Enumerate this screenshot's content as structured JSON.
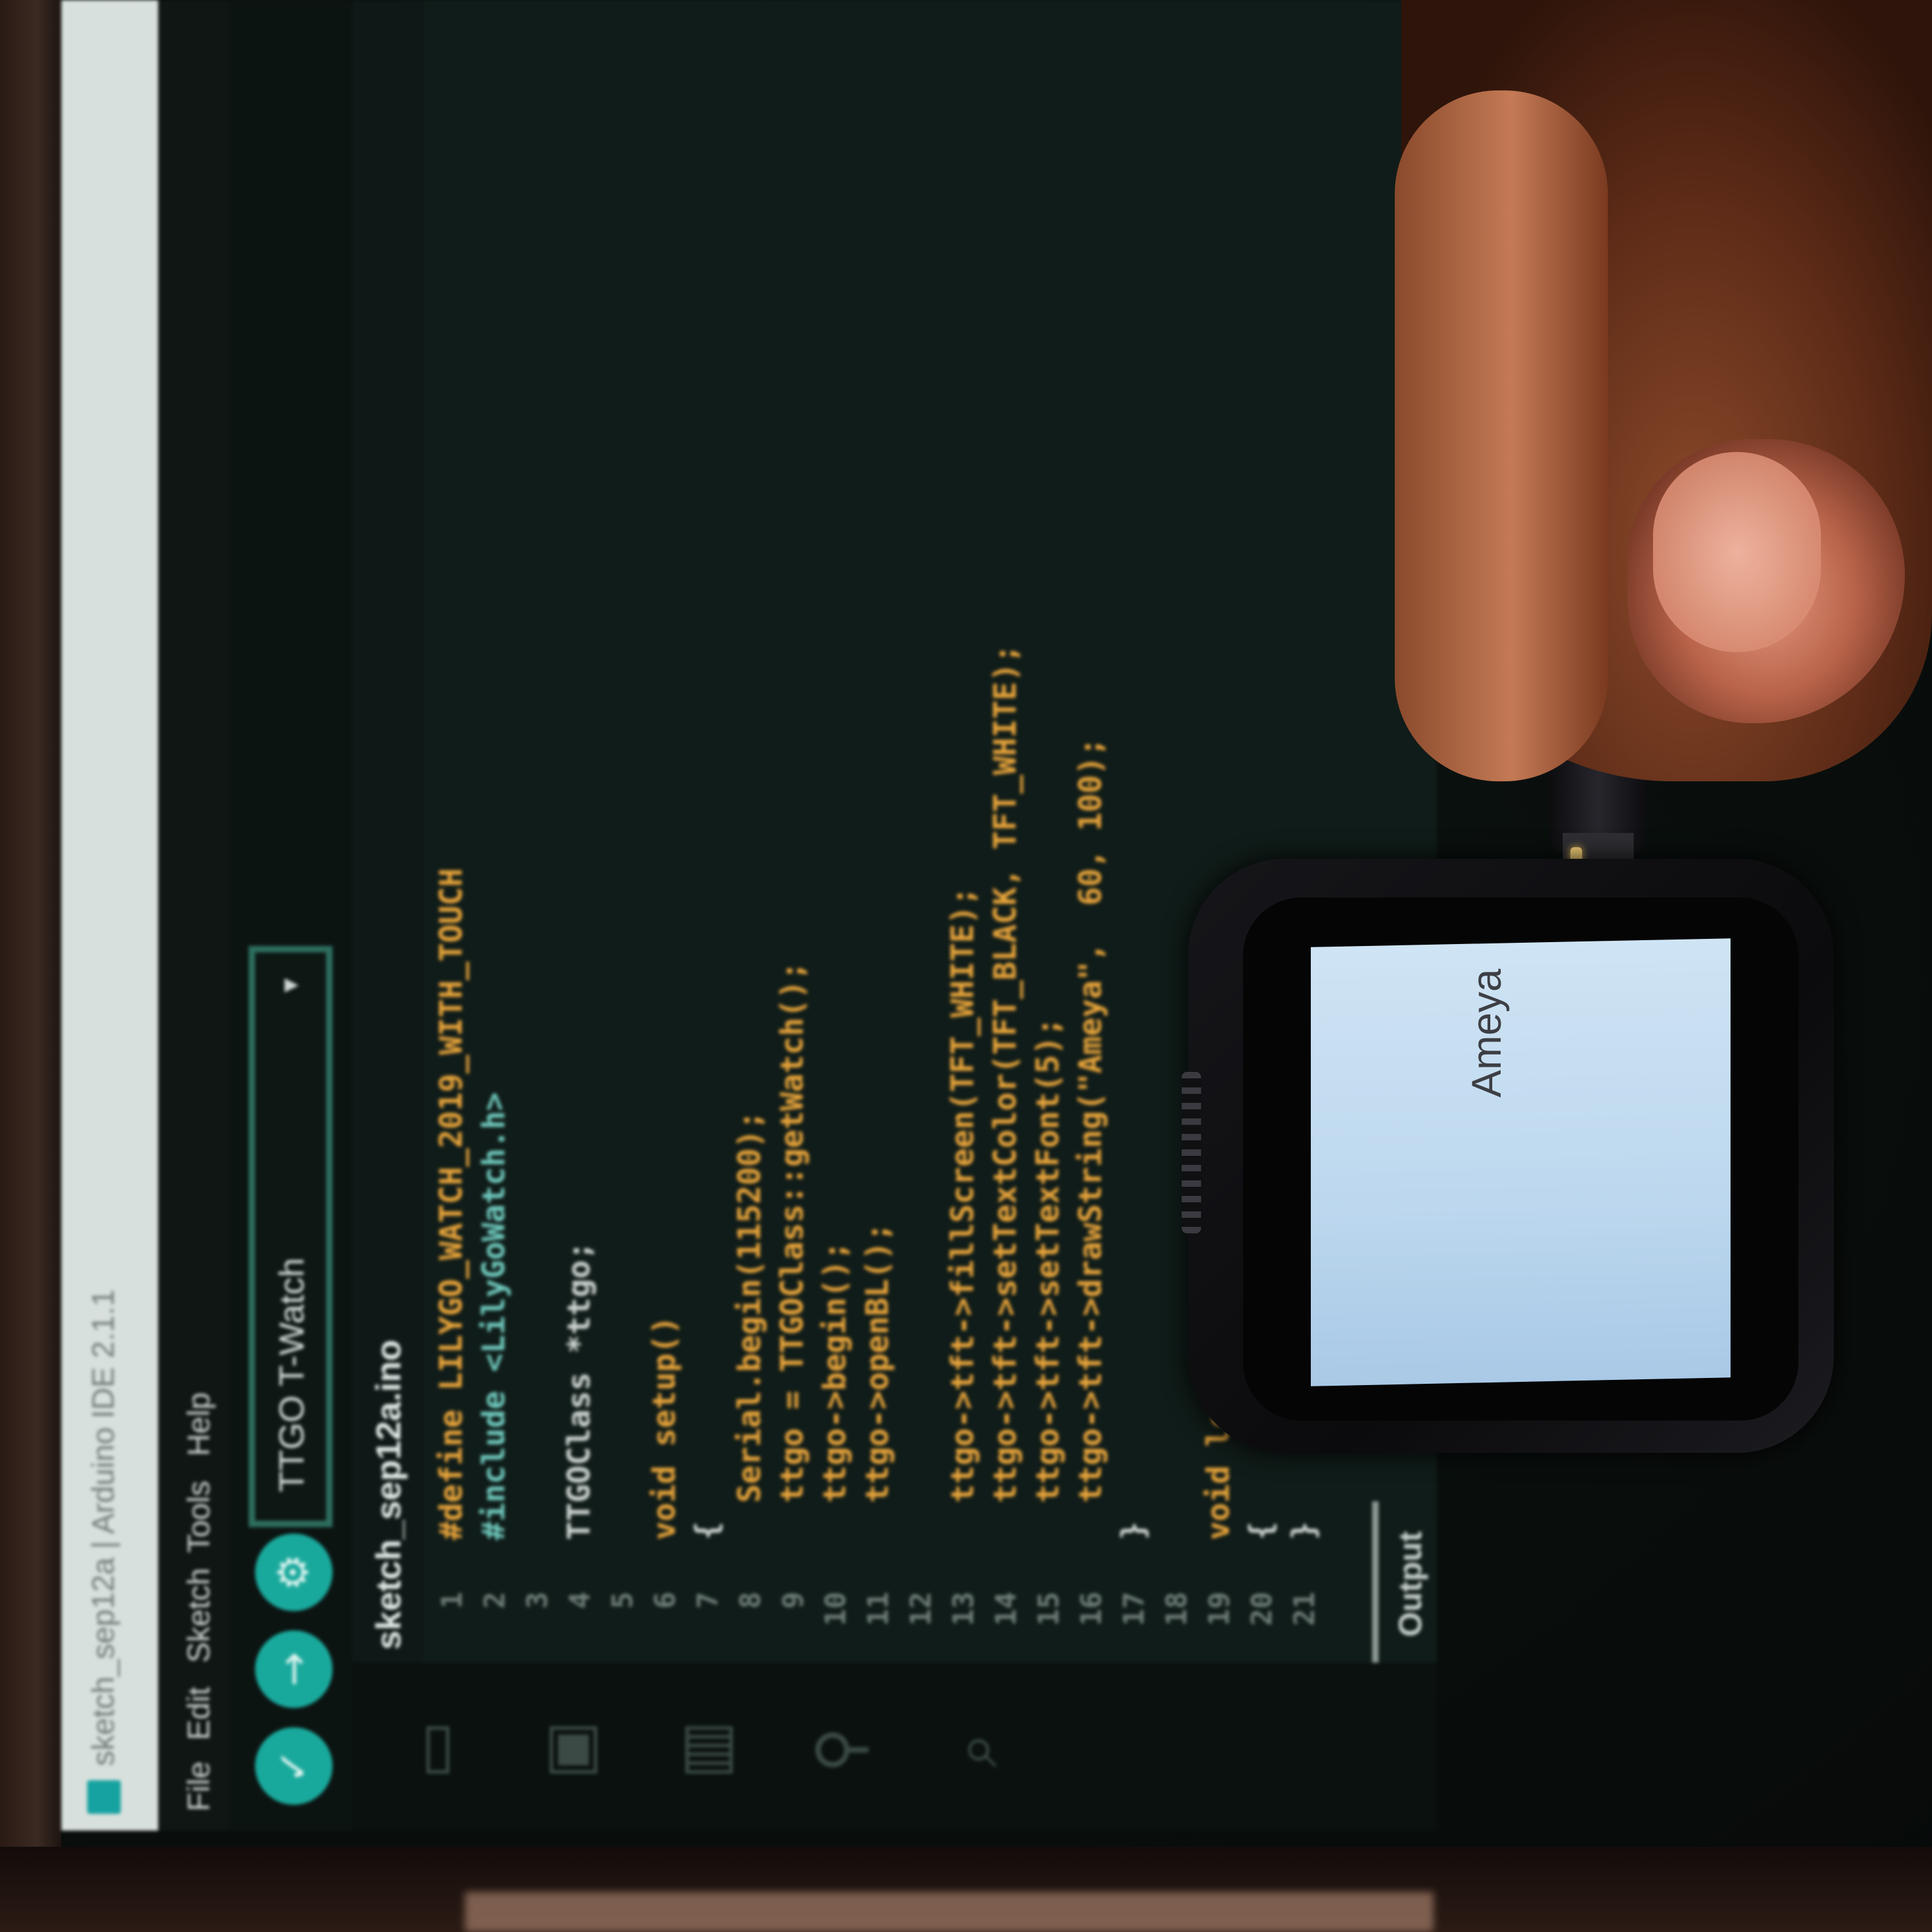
{
  "ide": {
    "title": "sketch_sep12a | Arduino IDE 2.1.1",
    "menu": [
      "File",
      "Edit",
      "Sketch",
      "Tools",
      "Help"
    ],
    "board": "TTGO T-Watch",
    "file_tab": "sketch_sep12a.ino",
    "output_tab": "Output",
    "line_numbers": [
      "1",
      "2",
      "3",
      "4",
      "5",
      "6",
      "7",
      "8",
      "9",
      "10",
      "11",
      "12",
      "13",
      "14",
      "15",
      "16",
      "17",
      "18",
      "19",
      "20",
      "21"
    ],
    "code": [
      {
        "text": "#define LILYGO_WATCH_2019_WITH_TOUCH",
        "color": "#e8a43a"
      },
      {
        "text": "#include <LilyGoWatch.h>",
        "color": "#6fc9bd"
      },
      {
        "text": "",
        "color": "#cfd6d3"
      },
      {
        "text": "TTGOClass *ttgo;",
        "color": "#cfd6d3"
      },
      {
        "text": "",
        "color": "#cfd6d3"
      },
      {
        "text": "void setup()",
        "color": "#e8a43a"
      },
      {
        "text": "{",
        "color": "#cfd6d3"
      },
      {
        "text": "  Serial.begin(115200);",
        "color": "#e8a43a"
      },
      {
        "text": "  ttgo = TTGOClass::getWatch();",
        "color": "#e8a43a"
      },
      {
        "text": "  ttgo->begin();",
        "color": "#e8a43a"
      },
      {
        "text": "  ttgo->openBL();",
        "color": "#e8a43a"
      },
      {
        "text": "",
        "color": "#cfd6d3"
      },
      {
        "text": "  ttgo->tft->fillScreen(TFT_WHITE);",
        "color": "#e8a43a"
      },
      {
        "text": "  ttgo->tft->setTextColor(TFT_BLACK, TFT_WHITE);",
        "color": "#e8a43a"
      },
      {
        "text": "  ttgo->tft->setTextFont(5);",
        "color": "#e8a43a"
      },
      {
        "text": "  ttgo->tft->drawString(\"Ameya\",  60, 100);",
        "color": "#e8a43a"
      },
      {
        "text": "}",
        "color": "#cfd6d3"
      },
      {
        "text": "",
        "color": "#cfd6d3"
      },
      {
        "text": "void loop()",
        "color": "#e8a43a"
      },
      {
        "text": "{",
        "color": "#cfd6d3"
      },
      {
        "text": "}",
        "color": "#cfd6d3"
      }
    ],
    "sidebar_icons": [
      "folder-icon",
      "board-icon",
      "library-icon",
      "debug-icon",
      "search-icon"
    ]
  },
  "watch": {
    "screen_text": "Ameya"
  }
}
